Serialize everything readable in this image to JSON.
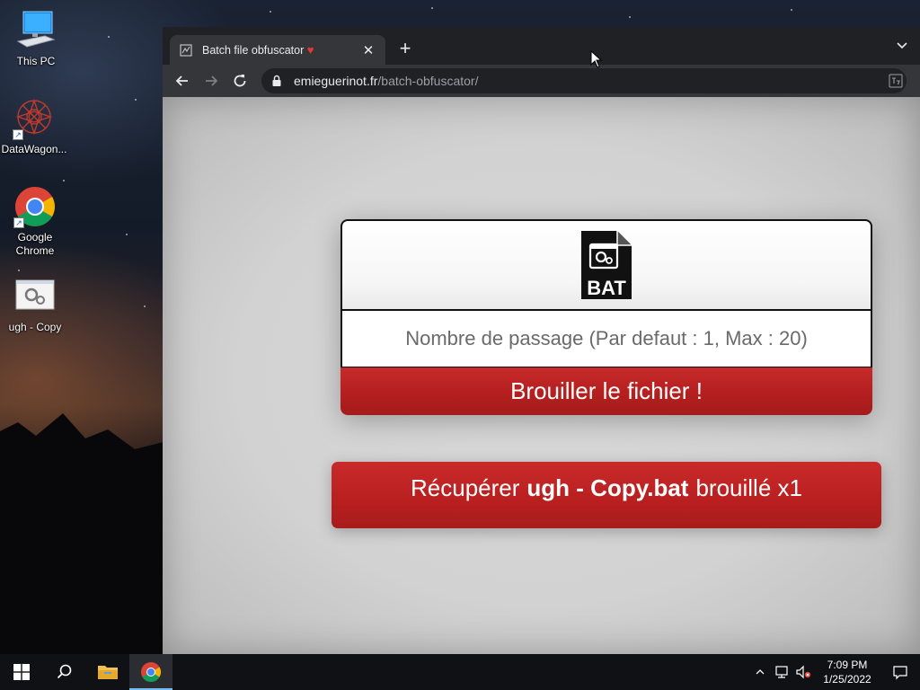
{
  "desktop": {
    "icons": [
      {
        "label": "This PC",
        "icon": "this-pc-icon"
      },
      {
        "label": "DataWagon...",
        "icon": "datawagon-icon"
      },
      {
        "label": "Google Chrome",
        "icon": "chrome-icon"
      },
      {
        "label": "ugh - Copy",
        "icon": "batch-file-icon"
      }
    ]
  },
  "browser": {
    "tab": {
      "title": "Batch file obfuscator",
      "title_heart": "♥",
      "close": "✕"
    },
    "new_tab": "+",
    "url": {
      "host": "emieguerinot.fr",
      "path": "/batch-obfuscator/"
    }
  },
  "page": {
    "file_badge": "BAT",
    "passes_placeholder": "Nombre de passage (Par defaut : 1, Max : 20)",
    "scramble_button": "Brouiller le fichier !",
    "download": {
      "prefix": "Récupérer",
      "filename": "ugh - Copy.bat",
      "suffix": "brouillé x1"
    },
    "accent": "#b91f1f"
  },
  "taskbar": {
    "time": "7:09 PM",
    "date": "1/25/2022"
  }
}
